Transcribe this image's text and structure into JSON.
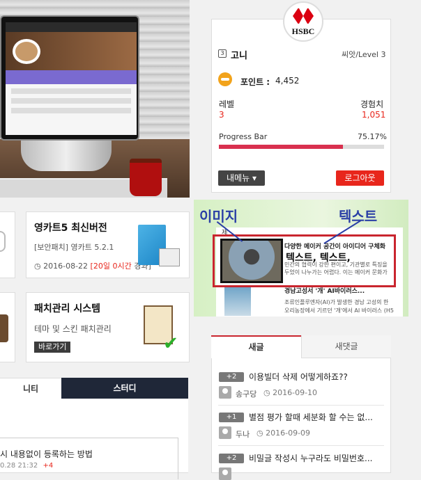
{
  "cards": {
    "top": {
      "title": "영카트5 최신버전",
      "subtitle": "[보안패치] 영카트 5.2.1",
      "date": "2016-08-22",
      "elapsed": "20일 0시간",
      "elapsed_suffix": "경과"
    },
    "bottom": {
      "title": "패치관리 시스템",
      "subtitle": "테마 및 스킨 패치관리",
      "button": "바로가기"
    }
  },
  "left_tabs": {
    "first": "니티",
    "second": "스터디"
  },
  "left_list": {
    "item_title": "시 내용없이 등록하는 방법",
    "item_meta": "0.28 21:32",
    "item_count": "+4"
  },
  "profile": {
    "logo_text": "HSBC",
    "nick_icon": "3",
    "nickname": "고니",
    "level_label": "씨앗/Level 3",
    "point_label": "포인트 :",
    "point_value": "4,452",
    "level_title": "레벨",
    "exp_title": "경험치",
    "level_value": "3",
    "exp_value": "1,051",
    "progress_label": "Progress Bar",
    "progress_text": "75.17%",
    "progress_value": 75.17,
    "menu_button": "내메뉴 ▾",
    "logout_button": "로그아웃"
  },
  "annotation": {
    "image_label": "이미지",
    "text_label": "텍스트",
    "feed_head": "제",
    "item1_title": "다양한 메이커 공간이 아이디어 구체화",
    "item1_overlay": "텍스트, 텍스트,",
    "item1_body_1": "                    에서 정부와",
    "item1_body_2": "민간의 협력이 강한 편이고, 기관별로 특징을",
    "item1_body_3": "두었이 나누가는 어렵다. 이는 메이커 문화가",
    "item2_title": "경남고성서 '개' AI바이러스...",
    "item2_body_1": "조류인플루엔자(AI)가 발생한 경남 고성의 한",
    "item2_body_2": "오리농장에서 기르던 '개'에서 AI 바이러스 (H5"
  },
  "posts": {
    "tab_new": "새글",
    "tab_comments": "새댓글",
    "items": [
      {
        "count": "+2",
        "title": "이용빌더 삭제 어떻게하죠??",
        "author": "송구당",
        "date": "2016-09-10"
      },
      {
        "count": "+1",
        "title": "별점 평가 할때 세분화 할 수는 없...",
        "author": "두나",
        "date": "2016-09-09"
      },
      {
        "count": "+2",
        "title": "비밀글 작성시 누구라도 비밀번호...",
        "author": "",
        "date": ""
      }
    ]
  },
  "colors": {
    "accent_red": "#e8261c",
    "progress_fill": "#d9304f",
    "annotation_blue": "#2a3fa6",
    "dark_tab": "#1f2738"
  }
}
